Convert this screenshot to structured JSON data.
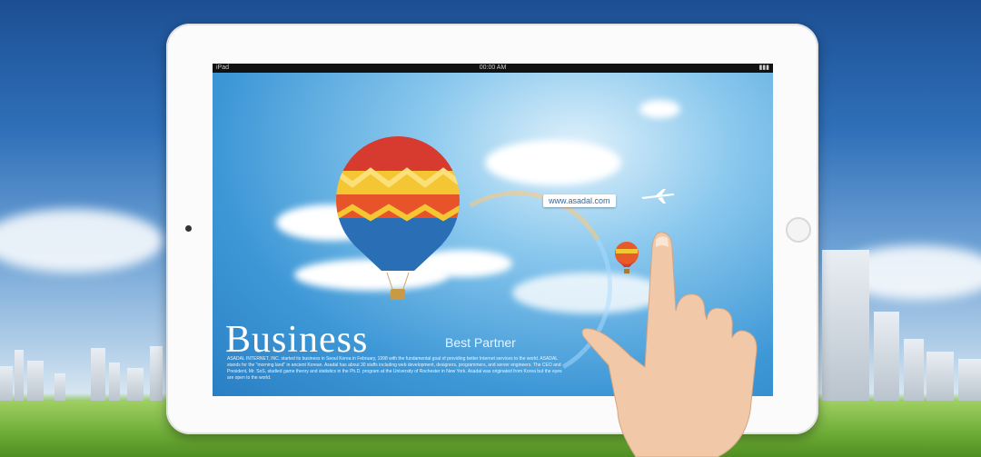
{
  "screen": {
    "statusbar": {
      "device": "iPad",
      "time": "00:00 AM",
      "battery": "▮▮▮"
    },
    "url_tag": "www.asadal.com",
    "headline": "Business",
    "subhead": "Best Partner",
    "body_text": "ASADAL INTERNET, INC. started its business in Seoul Korea in February, 1998 with the fundamental goal of providing better Internet services to the world. ASADAL stands for the \"morning land\" in ancient Korean. Asadal has about 30 staffs including web development, designers, programmers, and server engineers. The CEO and President, Mr. SoS, studied game theory and statistics in the Ph.D. program at the University of Rochester in New York. Asadal was originated from Korea but the eyes are open to the world."
  },
  "colors": {
    "sky_top": "#1c4f93",
    "screen_sky": "#3d97d6",
    "grass": "#6cab36",
    "tablet": "#fbfbfb"
  }
}
